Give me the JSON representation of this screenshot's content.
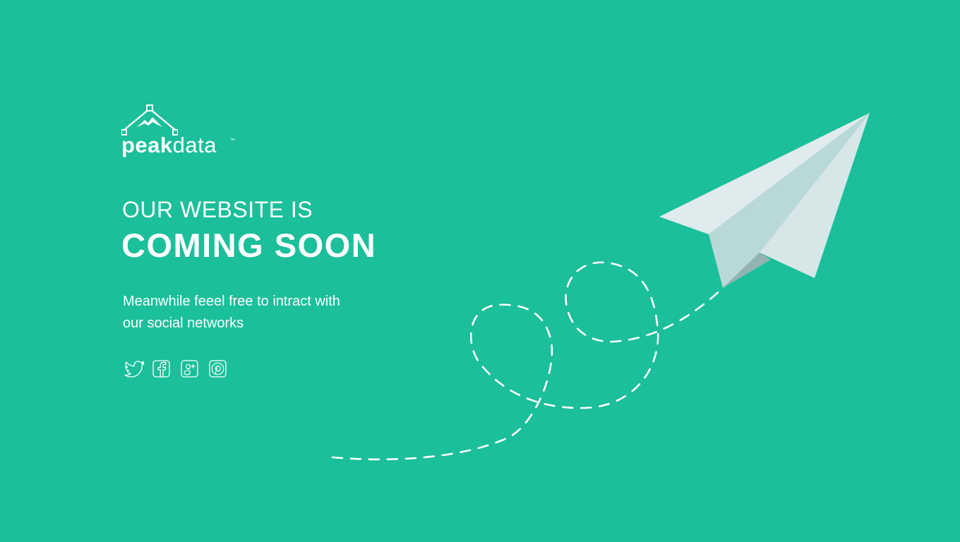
{
  "colors": {
    "background": "#1bbf9a",
    "text": "#ffffff",
    "plane_light": "#dce9ea",
    "plane_mid": "#b8d9d8",
    "plane_shadow": "#93b3b1"
  },
  "brand": {
    "word_bold": "peak",
    "word_light": "data",
    "trademark": "™",
    "mark_icon": "mountain-peak-icon"
  },
  "hero": {
    "line1": "OUR WEBSITE IS",
    "line2": "COMING SOON"
  },
  "tagline": {
    "line1": "Meanwhile feeel free to intract with",
    "line2": "our social networks"
  },
  "socials": [
    {
      "icon": "twitter-icon",
      "network": "twitter"
    },
    {
      "icon": "facebook-icon",
      "network": "facebook"
    },
    {
      "icon": "google-plus-icon",
      "network": "google-plus"
    },
    {
      "icon": "pinterest-icon",
      "network": "pinterest"
    }
  ],
  "illustration": {
    "icon": "paper-plane-icon",
    "trail": "dashed-flight-trail"
  }
}
